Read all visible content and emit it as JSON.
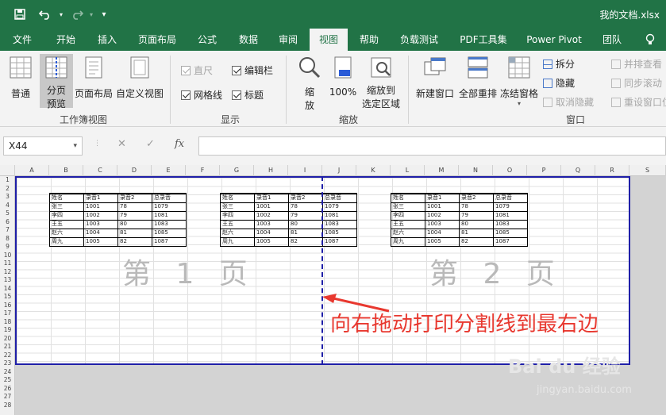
{
  "window": {
    "title": "我的文档.xlsx"
  },
  "quick_access": {
    "save_icon": "save-icon",
    "undo_icon": "undo-icon",
    "redo_icon": "redo-icon",
    "customize_icon": "customize-icon"
  },
  "tabs": [
    {
      "label": "文件"
    },
    {
      "label": "开始"
    },
    {
      "label": "插入"
    },
    {
      "label": "页面布局"
    },
    {
      "label": "公式"
    },
    {
      "label": "数据"
    },
    {
      "label": "审阅"
    },
    {
      "label": "视图"
    },
    {
      "label": "帮助"
    },
    {
      "label": "负载测试"
    },
    {
      "label": "PDF工具集"
    },
    {
      "label": "Power Pivot"
    },
    {
      "label": "团队"
    }
  ],
  "ribbon": {
    "workbook_views": {
      "normal": "普通",
      "page_break_line1": "分页",
      "page_break_line2": "预览",
      "page_layout": "页面布局",
      "custom_view": "自定义视图",
      "group_label": "工作簿视图"
    },
    "show": {
      "ruler": "直尺",
      "formula_bar": "编辑栏",
      "gridlines": "网格线",
      "headings": "标题",
      "group_label": "显示"
    },
    "zoom": {
      "zoom_line1": "缩",
      "zoom_line2": "放",
      "hundred": "100%",
      "zoom_sel_line1": "缩放到",
      "zoom_sel_line2": "选定区域",
      "group_label": "缩放"
    },
    "window": {
      "new_window": "新建窗口",
      "arrange_all": "全部重排",
      "freeze": "冻结窗格",
      "split": "拆分",
      "hide": "隐藏",
      "unhide": "取消隐藏",
      "side_by_side": "并排查看",
      "sync_scroll": "同步滚动",
      "reset_pos": "重设窗口位",
      "group_label": "窗口"
    }
  },
  "formula_bar": {
    "name_box": "X44",
    "cancel": "✕",
    "enter": "✓",
    "fx": "fx"
  },
  "columns": [
    "A",
    "B",
    "C",
    "D",
    "E",
    "F",
    "G",
    "H",
    "I",
    "J",
    "K",
    "L",
    "M",
    "N",
    "O",
    "P",
    "Q",
    "R",
    "S"
  ],
  "rows": [
    "1",
    "2",
    "3",
    "4",
    "5",
    "6",
    "7",
    "8",
    "9",
    "10",
    "11",
    "12",
    "13",
    "14",
    "15",
    "16",
    "17",
    "18",
    "19",
    "20",
    "21",
    "22",
    "23",
    "24",
    "25",
    "26",
    "27",
    "28"
  ],
  "table_header": [
    "姓名",
    "录音1",
    "录音2",
    "总录音"
  ],
  "table_rows": [
    [
      "张三",
      "1001",
      "78",
      "1079"
    ],
    [
      "李四",
      "1002",
      "79",
      "1081"
    ],
    [
      "王五",
      "1003",
      "80",
      "1083"
    ],
    [
      "赵六",
      "1004",
      "81",
      "1085"
    ],
    [
      "周九",
      "1005",
      "82",
      "1087"
    ]
  ],
  "watermarks": {
    "page1": "第 1 页",
    "page2": "第 2 页"
  },
  "annotation": "向右拖动打印分割线到最右边",
  "brand": {
    "logo": "Bai du 经验",
    "url": "jingyan.baidu.com"
  },
  "colors": {
    "excel_green": "#217346",
    "page_border": "#1f1fa8",
    "annotation": "#e8382f"
  }
}
